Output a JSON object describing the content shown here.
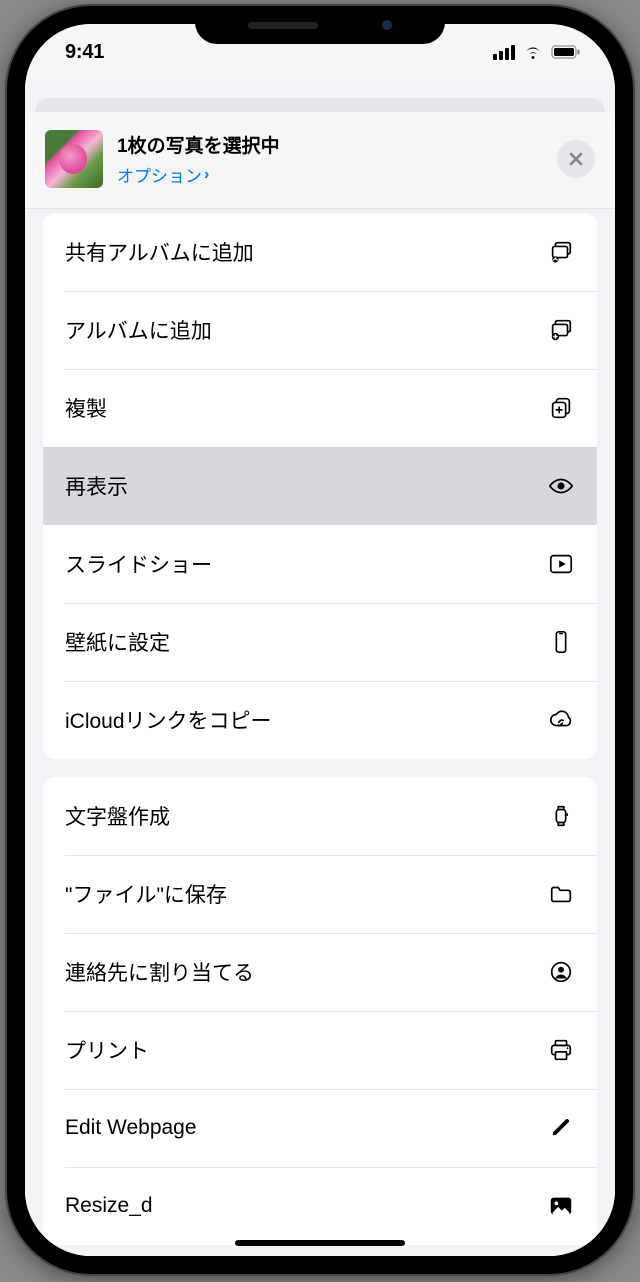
{
  "status": {
    "time": "9:41"
  },
  "header": {
    "title": "1枚の写真を選択中",
    "options": "オプション"
  },
  "groups": [
    {
      "rows": [
        {
          "label": "共有アルバムに追加",
          "icon": "shared-album-icon",
          "highlight": false
        },
        {
          "label": "アルバムに追加",
          "icon": "add-album-icon",
          "highlight": false
        },
        {
          "label": "複製",
          "icon": "duplicate-icon",
          "highlight": false
        },
        {
          "label": "再表示",
          "icon": "eye-icon",
          "highlight": true
        },
        {
          "label": "スライドショー",
          "icon": "play-icon",
          "highlight": false
        },
        {
          "label": "壁紙に設定",
          "icon": "phone-icon",
          "highlight": false
        },
        {
          "label": "iCloudリンクをコピー",
          "icon": "cloud-link-icon",
          "highlight": false
        }
      ]
    },
    {
      "rows": [
        {
          "label": "文字盤作成",
          "icon": "watch-icon",
          "highlight": false
        },
        {
          "label": "\"ファイル\"に保存",
          "icon": "folder-icon",
          "highlight": false
        },
        {
          "label": "連絡先に割り当てる",
          "icon": "contact-icon",
          "highlight": false
        },
        {
          "label": "プリント",
          "icon": "print-icon",
          "highlight": false
        },
        {
          "label": "Edit Webpage",
          "icon": "pencil-icon",
          "highlight": false
        },
        {
          "label": "Resize_d",
          "icon": "image-icon",
          "highlight": false
        }
      ]
    }
  ]
}
